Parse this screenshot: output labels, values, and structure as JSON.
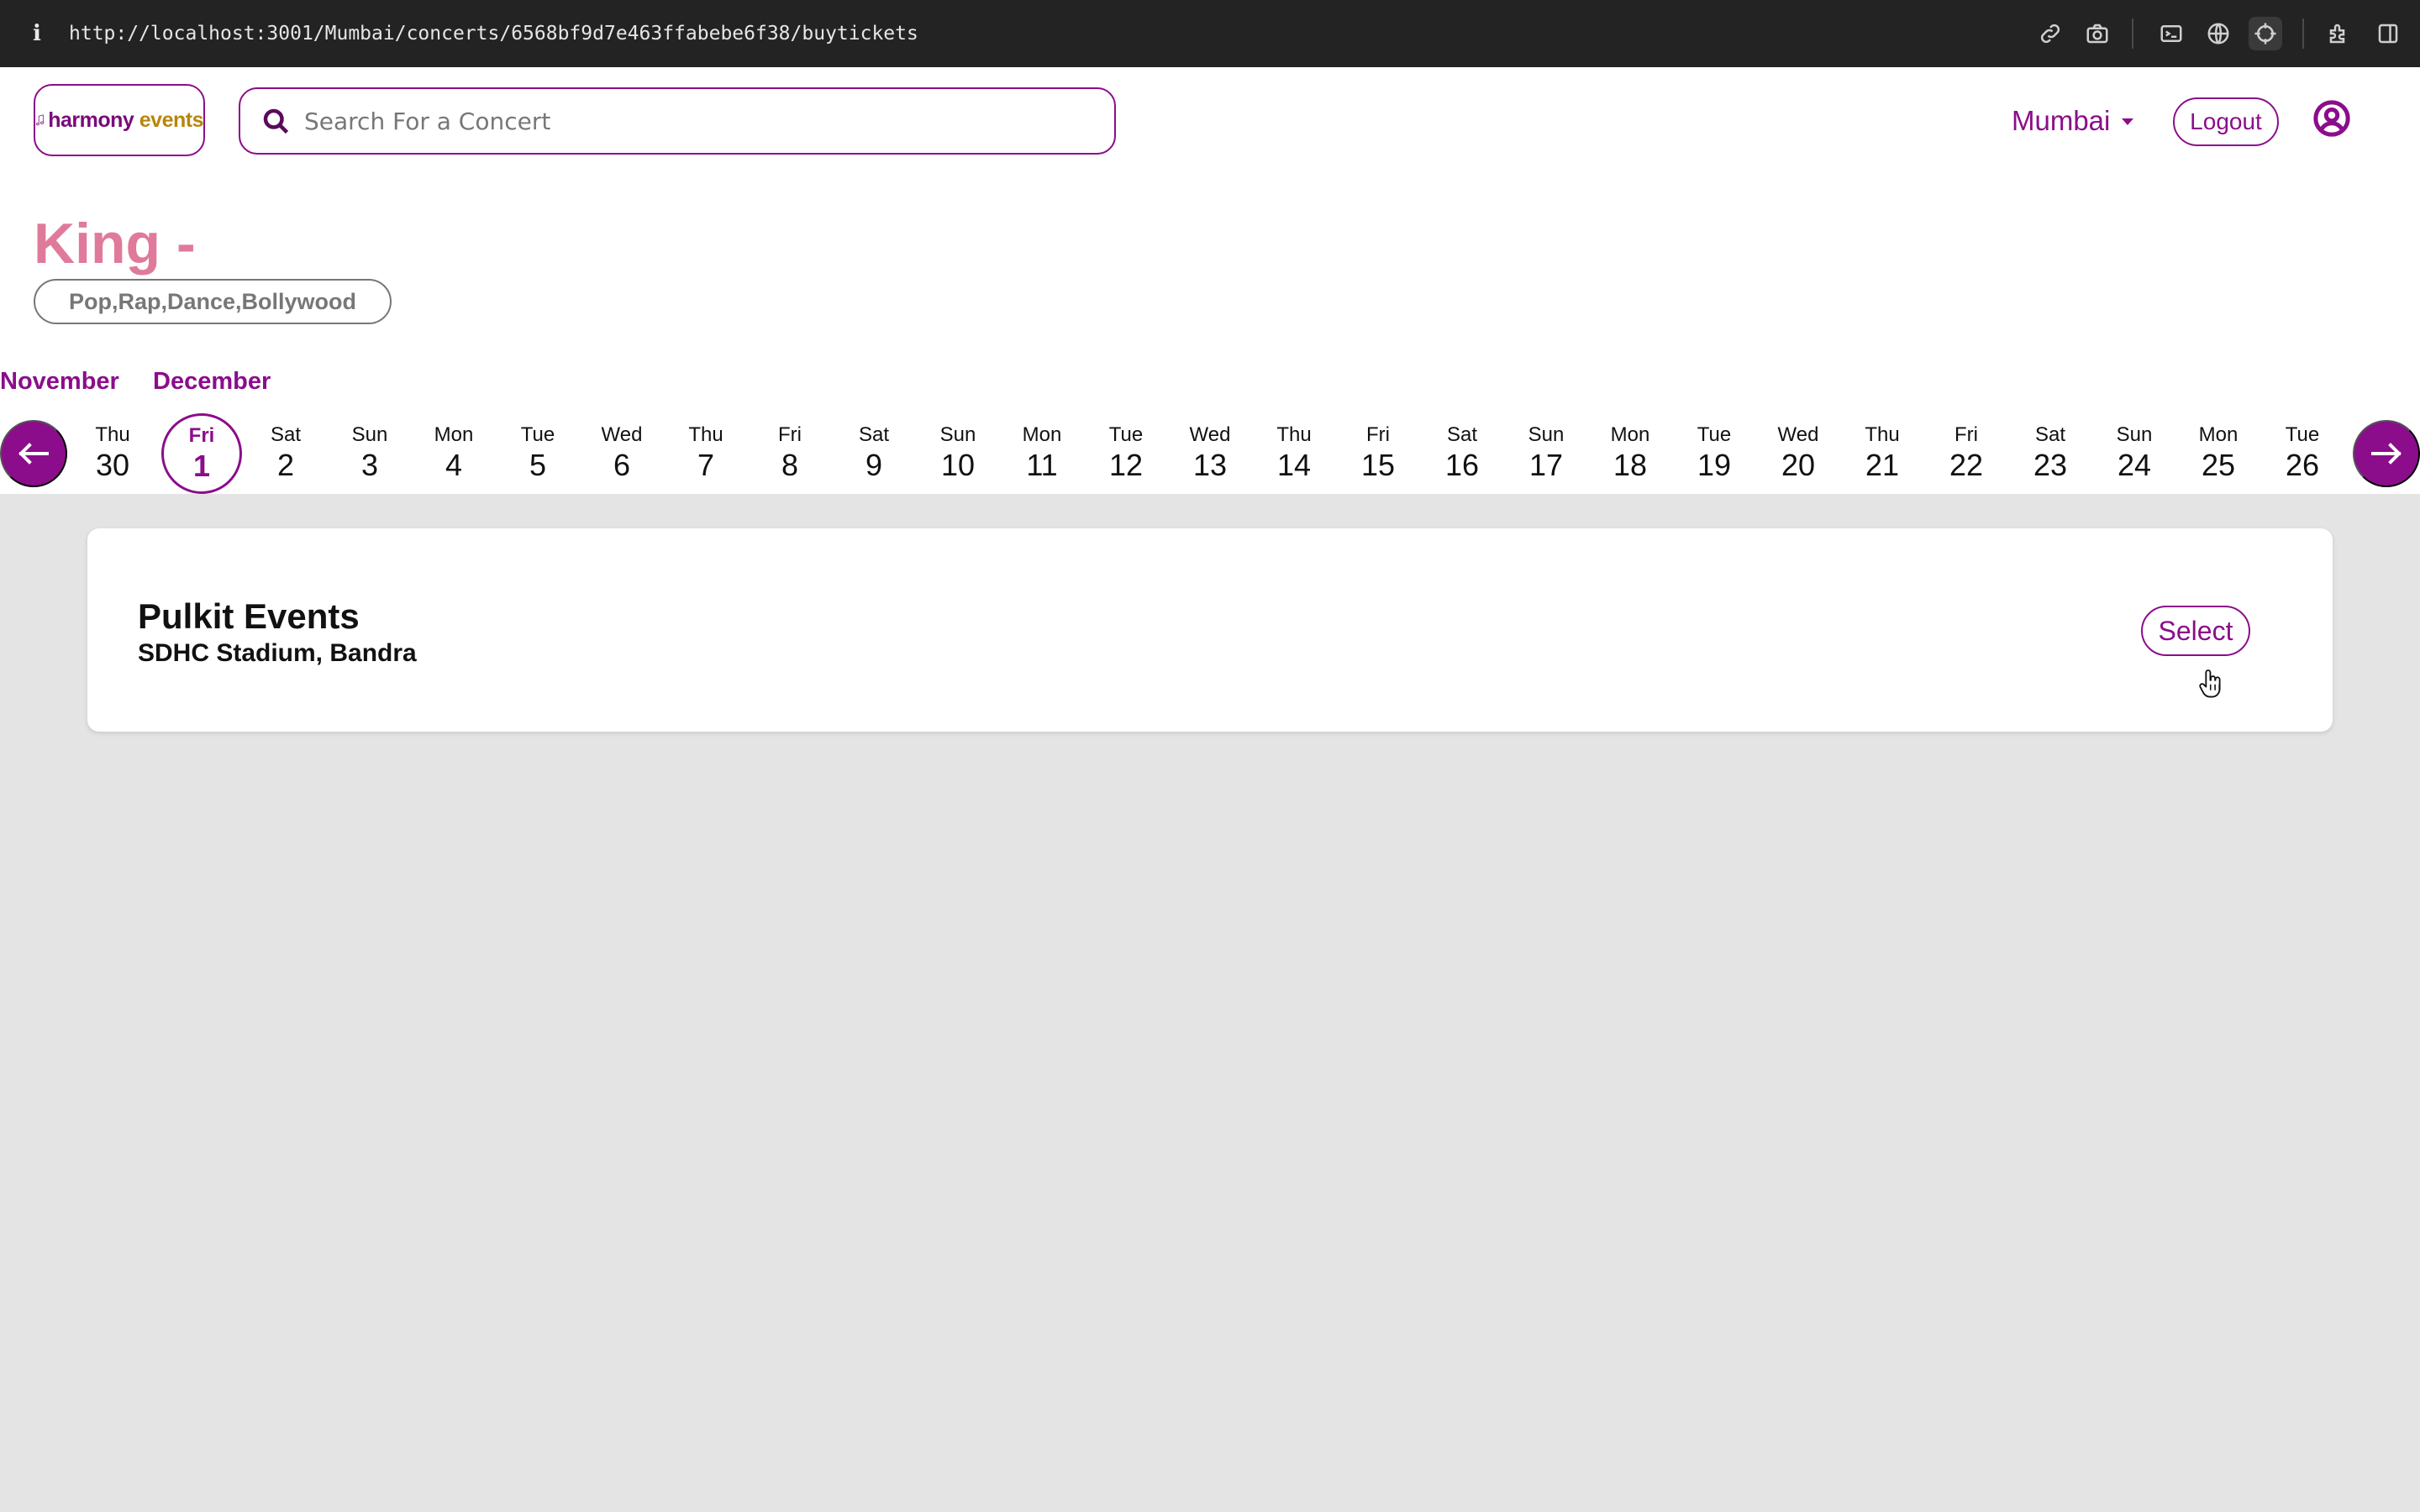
{
  "browser": {
    "url": "http://localhost:3001/Mumbai/concerts/6568bf9d7e463ffabebe6f38/buytickets",
    "info_glyph": "i"
  },
  "header": {
    "logo": {
      "word1": "harmony",
      "word2": "events",
      "icon": "music-note-icon"
    },
    "search": {
      "placeholder": "Search For a Concert",
      "value": ""
    },
    "city": "Mumbai",
    "logout_label": "Logout"
  },
  "concert": {
    "title": "King -",
    "genres": "Pop,Rap,Dance,Bollywood"
  },
  "calendar": {
    "months": [
      "November",
      "December"
    ],
    "selected_index": 1,
    "days": [
      {
        "dow": "Thu",
        "dom": "30"
      },
      {
        "dow": "Fri",
        "dom": "1"
      },
      {
        "dow": "Sat",
        "dom": "2"
      },
      {
        "dow": "Sun",
        "dom": "3"
      },
      {
        "dow": "Mon",
        "dom": "4"
      },
      {
        "dow": "Tue",
        "dom": "5"
      },
      {
        "dow": "Wed",
        "dom": "6"
      },
      {
        "dow": "Thu",
        "dom": "7"
      },
      {
        "dow": "Fri",
        "dom": "8"
      },
      {
        "dow": "Sat",
        "dom": "9"
      },
      {
        "dow": "Sun",
        "dom": "10"
      },
      {
        "dow": "Mon",
        "dom": "11"
      },
      {
        "dow": "Tue",
        "dom": "12"
      },
      {
        "dow": "Wed",
        "dom": "13"
      },
      {
        "dow": "Thu",
        "dom": "14"
      },
      {
        "dow": "Fri",
        "dom": "15"
      },
      {
        "dow": "Sat",
        "dom": "16"
      },
      {
        "dow": "Sun",
        "dom": "17"
      },
      {
        "dow": "Mon",
        "dom": "18"
      },
      {
        "dow": "Tue",
        "dom": "19"
      },
      {
        "dow": "Wed",
        "dom": "20"
      },
      {
        "dow": "Thu",
        "dom": "21"
      },
      {
        "dow": "Fri",
        "dom": "22"
      },
      {
        "dow": "Sat",
        "dom": "23"
      },
      {
        "dow": "Sun",
        "dom": "24"
      },
      {
        "dow": "Mon",
        "dom": "25"
      },
      {
        "dow": "Tue",
        "dom": "26"
      }
    ]
  },
  "venues": [
    {
      "organizer": "Pulkit Events",
      "venue": "SDHC Stadium, Bandra",
      "select_label": "Select"
    }
  ],
  "colors": {
    "brand": "#8b0d8b",
    "title_pink": "#e07a9a",
    "logo_gold": "#b8860b",
    "page_bg": "#e4e4e4"
  }
}
